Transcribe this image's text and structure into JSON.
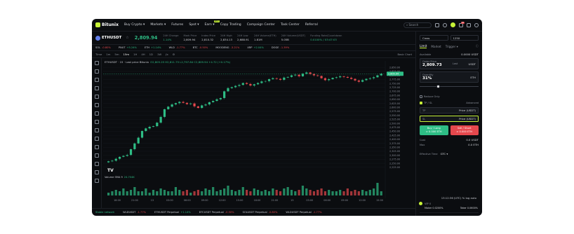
{
  "nav": {
    "brand": "Bitunix",
    "items": [
      {
        "label": "Buy Crypto ▾"
      },
      {
        "label": "Markets ▾"
      },
      {
        "label": "Futures"
      },
      {
        "label": "Spot ▾"
      },
      {
        "label": "Earn ▾",
        "badge": "NEW"
      },
      {
        "label": "Copy Trading"
      },
      {
        "label": "Campaign Center"
      },
      {
        "label": "Task Center"
      },
      {
        "label": "Referral"
      }
    ],
    "search_placeholder": "Search",
    "notification_count": "10"
  },
  "ticker": {
    "pair": "ETHUSDT",
    "last_price": "2,809.94",
    "stats": [
      {
        "key": "24H Change",
        "value": "1.14%",
        "up": true
      },
      {
        "key": "Mark Price",
        "value": "2,809.94"
      },
      {
        "key": "Index Price",
        "value": "2,810.32"
      },
      {
        "key": "24H High",
        "value": "2,834.13"
      },
      {
        "key": "24H Low",
        "value": "2,688.91"
      },
      {
        "key": "24H Volume(ETH)",
        "value": "1.81M"
      },
      {
        "key": "24H Volume(USDT)",
        "value": "5.05B"
      },
      {
        "key": "Funding Rate/Countdown",
        "value": "0.0100% / 03:47:03",
        "up": true
      }
    ]
  },
  "favorites": [
    {
      "name": "SOL",
      "pct": "-0.80%",
      "up": false
    },
    {
      "name": "PNUT",
      "pct": "+5.24%",
      "up": true
    },
    {
      "name": "ETH",
      "pct": "+1.14%",
      "up": true
    },
    {
      "name": "WLD",
      "pct": "-1.77%",
      "up": false
    },
    {
      "name": "BTC",
      "pct": "-0.50%",
      "up": false
    },
    {
      "name": "MOODENG",
      "pct": "-3.21%",
      "up": false
    },
    {
      "name": "XRP",
      "pct": "+2.04%",
      "up": true
    },
    {
      "name": "DOGE",
      "pct": "-1.39%",
      "up": false
    }
  ],
  "chart_toolbar": {
    "timeframes": [
      "Time",
      "1m",
      "5m",
      "15m",
      "1H",
      "4H",
      "1D",
      "1W"
    ],
    "active": "15m",
    "right_label": "Basic Chart"
  },
  "chart_title": {
    "text": "ETHUSDT · 15 · Last price Bitunix",
    "ohlc": "O2,805.25 H2,811.75 L2,797.84 C2,809.94 +4.72 (+0.17%)"
  },
  "volume_label": {
    "text": "Volume SMA 9",
    "value": "24.704K"
  },
  "clock": "13:12:36 (UTC)   %   log   auto",
  "bottom_bar": {
    "status": "Stable network",
    "items": [
      {
        "name": "WLDUSDT",
        "pct": "-1.77%"
      },
      {
        "name": "ETHUSDT Perpetual",
        "pct": "+1.14%"
      },
      {
        "name": "BTCUSDT Perpetual",
        "pct": "-0.50%"
      },
      {
        "name": "SOLUSDT Perpetual",
        "pct": "-0.80%"
      },
      {
        "name": "WLDUSDT Perpetual",
        "pct": "-1.77%"
      }
    ]
  },
  "order": {
    "margin_mode": "Cross",
    "leverage": "125X",
    "tabs": [
      "Limit",
      "Market",
      "Trigger ▾"
    ],
    "available_label": "Available",
    "available_value": "0.0000 USDT",
    "order_price_label": "Order Price",
    "order_price_value": "2,809.73",
    "last_label": "Last",
    "price_unit": "USDT",
    "quantity_label": "Quantity",
    "quantity_value": "31%",
    "qty_unit": "ETH",
    "slider_level": 0.31,
    "reduce_only": "Reduce Only",
    "tpsl": "TP / SL",
    "advanced": "Advanced",
    "tp_label": "TP",
    "tp_type": "Price (USDT)",
    "sl_label": "SL",
    "sl_type": "Price (USDT)",
    "buy_label": "Buy / Long",
    "buy_sub": "≈ 0.000 ETH",
    "sell_label": "Sell / Short",
    "sell_sub": "≈ 0.000 ETH",
    "cost_label": "Cost",
    "cost_value": "0.0 USDT",
    "max_label": "Max",
    "max_value": "0.0 ETH",
    "effective_label": "Effective Time",
    "effective_value": "GTC ▾",
    "vip_label": "VIP 0",
    "maker": "Maker 0.0200%",
    "taker": "Taker 0.0600%"
  },
  "colors": {
    "up": "#2ebd85",
    "down": "#e5484d",
    "accent": "#c7f337",
    "bg": "#0b0d10"
  },
  "chart_data": {
    "type": "candlestick",
    "title": "ETHUSDT · 15 · Last price Bitunix",
    "y_ticks": [
      "2,850.00",
      "2,825.00",
      "2,800.00",
      "2,775.00",
      "2,750.00",
      "2,725.00",
      "2,700.00",
      "2,675.00",
      "2,650.00",
      "2,625.00",
      "2,600.00",
      "2,575.00",
      "2,550.00",
      "2,525.00",
      "2,500.00",
      "2,475.00",
      "2,450.00",
      "2,425.00",
      "2,400.00",
      "2,375.00",
      "2,350.00",
      "2,325.00",
      "2,300.00",
      "2,275.00",
      "2,250.00",
      "2,225.00"
    ],
    "ylim": [
      2215,
      2855
    ],
    "x_ticks": [
      "18:00",
      "21:00",
      "13",
      "03:00",
      "06:00",
      "09:00",
      "12:00",
      "15:00",
      "18:00",
      "21:00",
      "15",
      "03:00",
      "06:00",
      "09:00",
      "12:00",
      "15:00"
    ],
    "close": [
      2262,
      2266,
      2278,
      2290,
      2296,
      2302,
      2338,
      2374,
      2410,
      2452,
      2468,
      2478,
      2482,
      2504,
      2540,
      2588,
      2604,
      2618,
      2626,
      2634,
      2628,
      2620,
      2624,
      2606,
      2596,
      2612,
      2618,
      2632,
      2640,
      2650,
      2658,
      2700,
      2720,
      2726,
      2734,
      2740,
      2752,
      2746,
      2736,
      2744,
      2752,
      2762,
      2764,
      2776,
      2782,
      2778,
      2772,
      2786,
      2790,
      2800,
      2804,
      2794,
      2810,
      2818,
      2808,
      2800,
      2796,
      2782,
      2770,
      2776,
      2784,
      2788,
      2794,
      2790,
      2785,
      2778,
      2768,
      2760,
      2770,
      2778,
      2782,
      2788,
      2800,
      2810
    ],
    "volume_level": [
      0.2,
      0.3,
      0.4,
      0.3,
      0.5,
      0.3,
      0.4,
      0.6,
      0.3,
      0.3,
      0.5,
      0.2,
      0.4,
      0.3,
      0.5,
      0.4,
      0.3,
      0.3,
      0.6,
      0.4,
      0.3,
      0.4,
      0.2,
      0.3,
      0.4,
      0.3,
      0.5,
      0.4,
      0.6,
      0.3,
      0.4,
      0.5,
      0.7,
      0.4,
      0.3,
      0.4,
      0.6,
      0.4,
      0.3,
      0.5,
      0.4,
      0.3,
      0.4,
      0.3,
      0.5,
      0.4,
      0.3,
      0.5,
      0.6,
      0.4,
      0.3,
      0.4,
      0.7,
      0.5,
      0.4,
      0.3,
      0.4,
      0.5,
      0.3,
      0.4,
      0.3,
      0.3,
      0.4,
      0.3,
      0.5,
      0.3,
      0.4,
      0.3,
      0.4,
      0.3,
      0.4,
      0.5,
      0.9,
      0.3
    ]
  }
}
